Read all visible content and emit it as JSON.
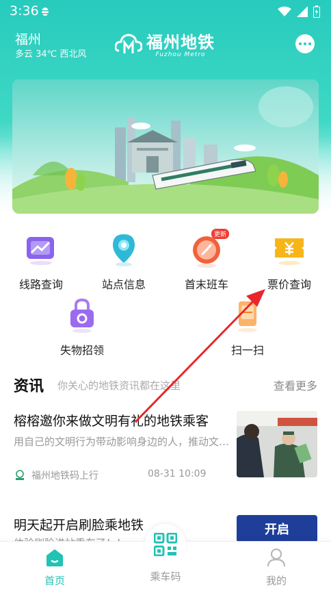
{
  "status_bar": {
    "time": "3:36"
  },
  "header": {
    "city": "福州",
    "weather": "多云 34℃ 西北风",
    "logo_text": "福州地铁",
    "logo_sub": "Fuzhou Metro"
  },
  "services": [
    {
      "label": "线路查询"
    },
    {
      "label": "站点信息"
    },
    {
      "label": "首末班车",
      "badge": "更新"
    },
    {
      "label": "票价查询"
    },
    {
      "label": "失物招领"
    },
    {
      "label": "扫一扫"
    }
  ],
  "news": {
    "title": "资讯",
    "subtitle": "你关心的地铁资讯都在这里",
    "more_label": "查看更多",
    "articles": [
      {
        "title": "榕榕邀你来做文明有礼的地铁乘客",
        "desc": "用自己的文明行为带动影响身边的人，推动文明乘车",
        "source": "福州地铁码上行",
        "time": "08-31 10:09"
      },
      {
        "title": "明天起开启刷脸乘地铁",
        "desc": "体验刷脸进站乘车了！！",
        "thumb_text": "开启"
      }
    ]
  },
  "tabbar": {
    "home": "首页",
    "ride_code": "乘车码",
    "mine": "我的"
  },
  "colors": {
    "brand": "#27cbbd",
    "annotation_arrow": "#e8262b",
    "tab_active": "#22c2b4",
    "tab_inactive": "#9a9a9a"
  }
}
